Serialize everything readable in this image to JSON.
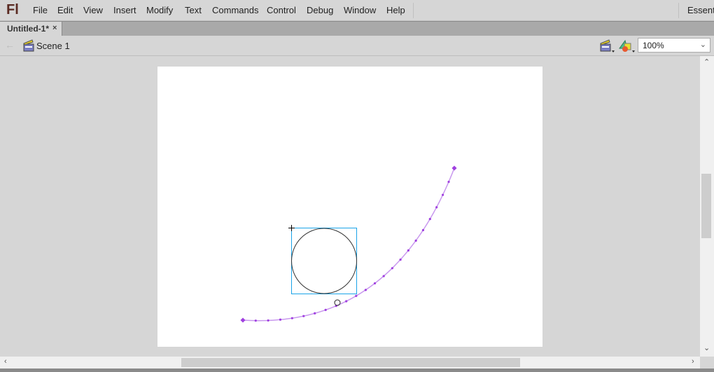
{
  "app": {
    "logo": "Fl",
    "workspace": "Essentials"
  },
  "menu": [
    "File",
    "Edit",
    "View",
    "Insert",
    "Modify",
    "Text",
    "Commands",
    "Control",
    "Debug",
    "Window",
    "Help"
  ],
  "document_tab": {
    "title": "Untitled-1*",
    "close": "×"
  },
  "scene_bar": {
    "back_icon": "arrow-left-icon",
    "scene_icon": "clapperboard-icon",
    "scene": "Scene 1",
    "zoom": "100%"
  },
  "colors": {
    "motion_path": "#a040e0",
    "selection": "#1aa3e8",
    "stage": "#ffffff",
    "chrome": "#d6d6d6"
  }
}
